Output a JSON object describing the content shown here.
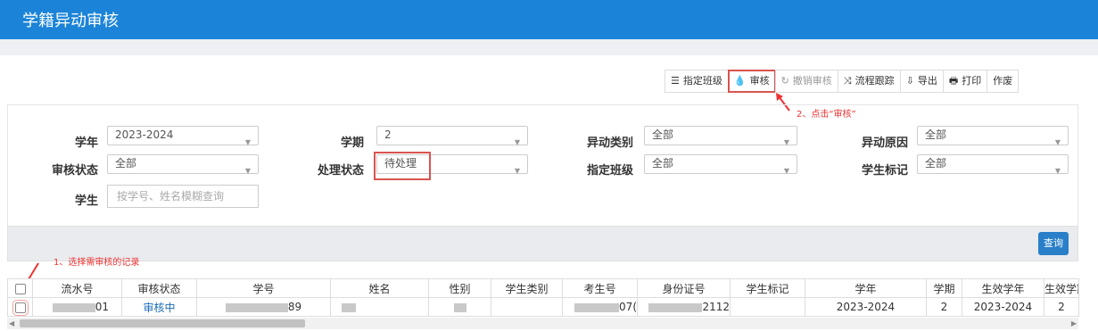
{
  "header": {
    "title": "学籍异动审核"
  },
  "toolbar": {
    "buttons": [
      {
        "icon": "list-icon",
        "glyph": "☰",
        "label": "指定班级"
      },
      {
        "icon": "drop-icon",
        "glyph": "💧",
        "label": "审核"
      },
      {
        "icon": "undo-icon",
        "glyph": "↻",
        "label": "撤销审核"
      },
      {
        "icon": "shuffle-icon",
        "glyph": "⤨",
        "label": "流程跟踪"
      },
      {
        "icon": "export-icon",
        "glyph": "⇩",
        "label": "导出"
      },
      {
        "icon": "print-icon",
        "glyph": "🖶",
        "label": "打印"
      },
      {
        "icon": "",
        "glyph": "",
        "label": "作废"
      }
    ]
  },
  "annotations": {
    "step1": "1、选择需审核的记录",
    "step2": "2、点击“审核”"
  },
  "filters": {
    "school_year": {
      "label": "学年",
      "value": "2023-2024"
    },
    "term": {
      "label": "学期",
      "value": "2"
    },
    "change_type": {
      "label": "异动类别",
      "value": "全部"
    },
    "change_reason": {
      "label": "异动原因",
      "value": "全部"
    },
    "review_status": {
      "label": "审核状态",
      "value": "全部"
    },
    "process_status": {
      "label": "处理状态",
      "value": "待处理"
    },
    "assigned_class": {
      "label": "指定班级",
      "value": "全部"
    },
    "student_mark": {
      "label": "学生标记",
      "value": "全部"
    },
    "student": {
      "label": "学生",
      "placeholder": "按学号、姓名模糊查询"
    }
  },
  "query_button": "查询",
  "table": {
    "columns": [
      "流水号",
      "审核状态",
      "学号",
      "姓名",
      "性别",
      "学生类别",
      "考生号",
      "身份证号",
      "学生标记",
      "学年",
      "学期",
      "生效学年",
      "生效学期"
    ],
    "row": {
      "serial_tail": "01",
      "review_status": "审核中",
      "student_no_tail": "89",
      "exam_no_tail": "07(",
      "id_tail": "2112",
      "school_year": "2023-2024",
      "term": "2",
      "effective_year": "2023-2024",
      "effective_term": "2"
    }
  },
  "colors": {
    "header": "#1b84d8",
    "highlight": "#d9534f",
    "link": "#1b6db8",
    "query": "#2a7fc9"
  }
}
